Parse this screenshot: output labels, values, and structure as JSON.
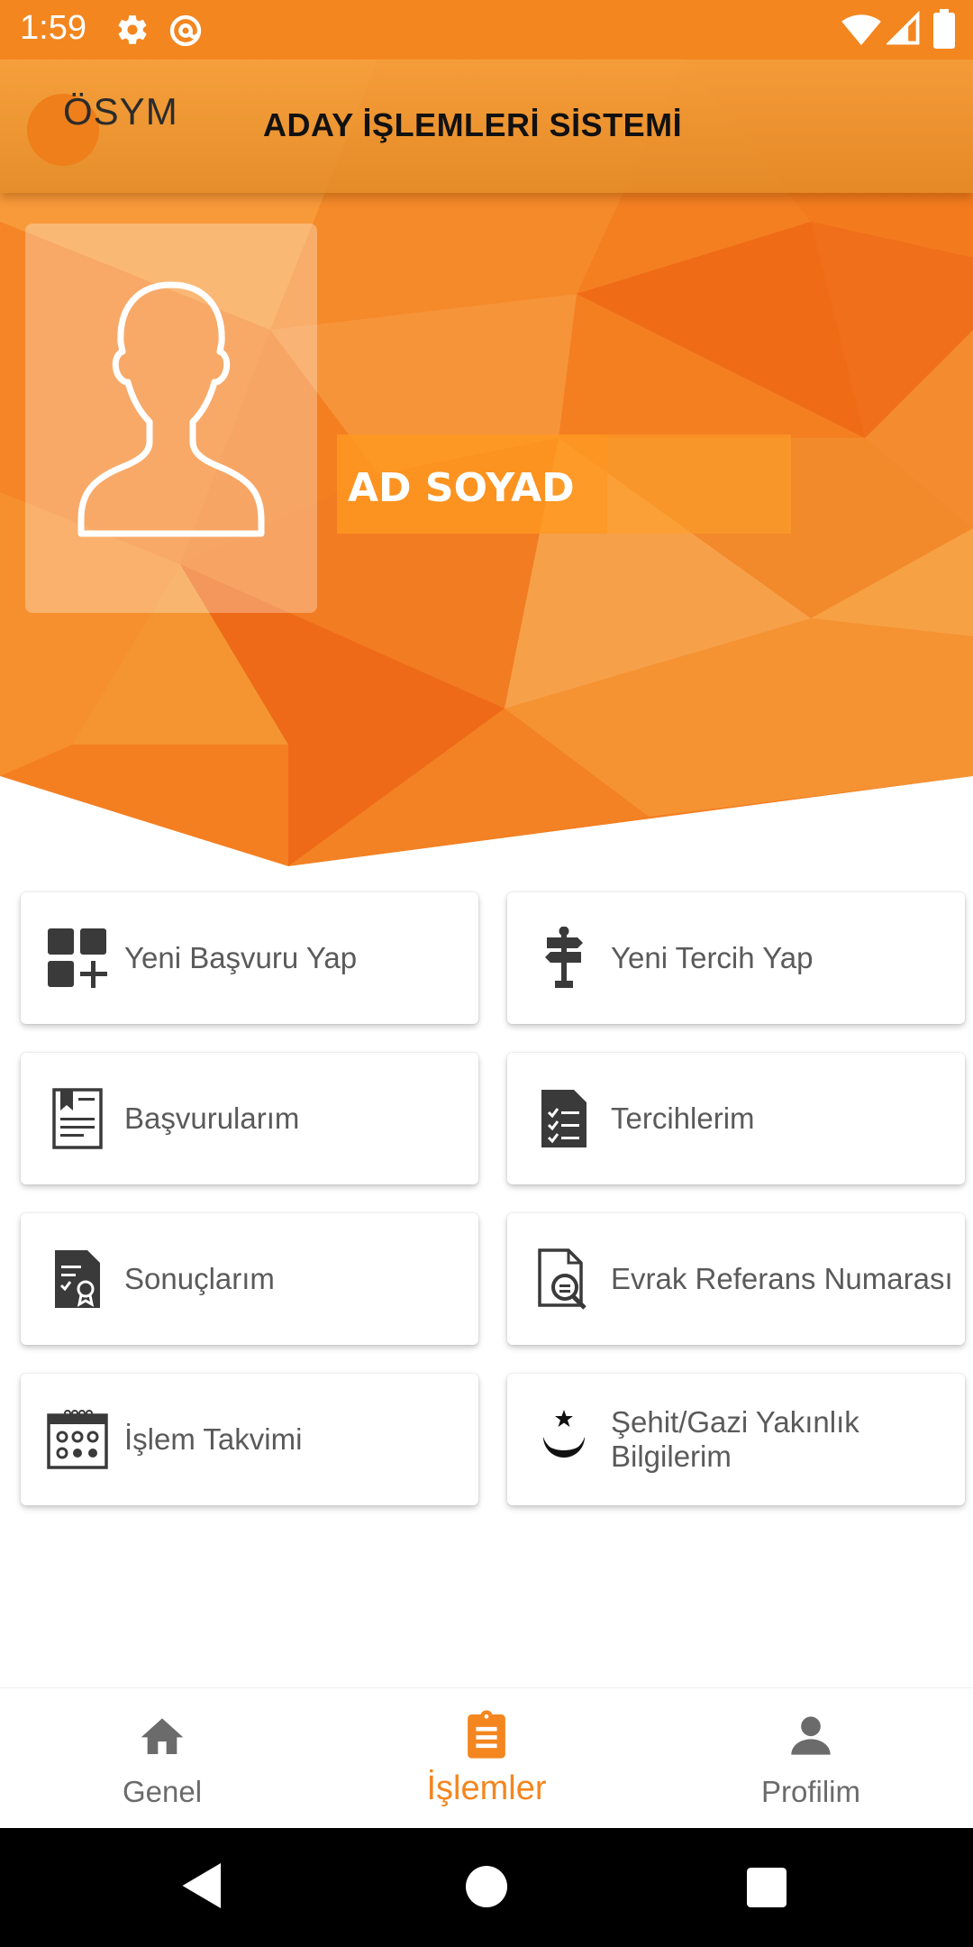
{
  "status_bar": {
    "time": "1:59",
    "icons": [
      "settings-icon",
      "at-sign-icon",
      "wifi-icon",
      "signal-icon",
      "battery-icon"
    ]
  },
  "header": {
    "logo_text": "ÖSYM",
    "title": "ADAY İŞLEMLERİ SİSTEMİ"
  },
  "profile": {
    "name": "AD SOYAD"
  },
  "menu": {
    "items": [
      {
        "label": "Yeni Başvuru Yap",
        "icon": "grid-plus-icon"
      },
      {
        "label": "Yeni Tercih Yap",
        "icon": "signpost-icon"
      },
      {
        "label": "Başvurularım",
        "icon": "bookmark-document-icon"
      },
      {
        "label": "Tercihlerim",
        "icon": "checklist-document-icon"
      },
      {
        "label": "Sonuçlarım",
        "icon": "certificate-document-icon"
      },
      {
        "label": "Evrak Referans Numarası",
        "icon": "document-search-icon"
      },
      {
        "label": "İşlem Takvimi",
        "icon": "calendar-icon"
      },
      {
        "label": "Şehit/Gazi Yakınlık Bilgilerim",
        "icon": "crescent-star-icon"
      }
    ]
  },
  "bottom_nav": {
    "items": [
      {
        "label": "Genel",
        "icon": "home-icon"
      },
      {
        "label": "İşlemler",
        "icon": "clipboard-icon",
        "active": true
      },
      {
        "label": "Profilim",
        "icon": "person-icon"
      }
    ]
  },
  "colors": {
    "accent": "#f3861f",
    "text_muted": "#5a5a5a",
    "icon_dark": "#3a3a3a"
  }
}
